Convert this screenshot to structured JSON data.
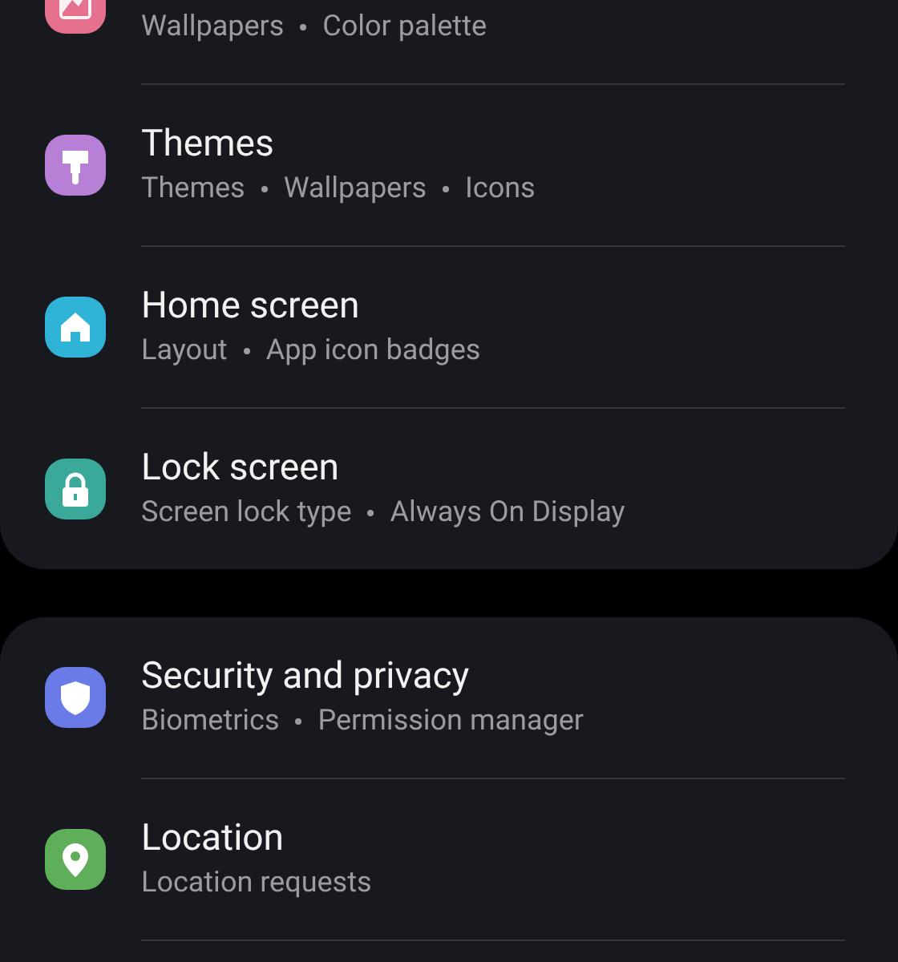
{
  "groups": [
    {
      "items": [
        {
          "color": "#e5718f",
          "details": [
            "Wallpapers",
            "Color palette"
          ]
        },
        {
          "color": "#b77fd6",
          "title": "Themes",
          "details": [
            "Themes",
            "Wallpapers",
            "Icons"
          ]
        },
        {
          "color": "#2fb3d6",
          "title": "Home screen",
          "details": [
            "Layout",
            "App icon badges"
          ]
        },
        {
          "color": "#3aa99a",
          "title": "Lock screen",
          "details": [
            "Screen lock type",
            "Always On Display"
          ]
        }
      ]
    },
    {
      "items": [
        {
          "color": "#6a7be8",
          "title": "Security and privacy",
          "details": [
            "Biometrics",
            "Permission manager"
          ]
        },
        {
          "color": "#5fae5a",
          "title": "Location",
          "details": [
            "Location requests"
          ]
        }
      ]
    }
  ]
}
